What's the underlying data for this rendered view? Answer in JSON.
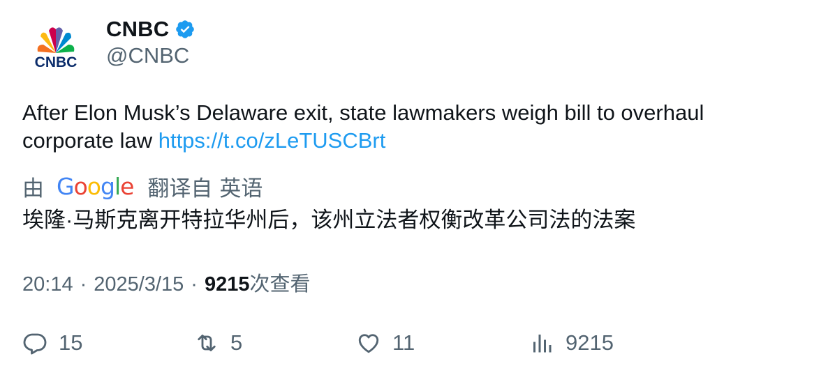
{
  "author": {
    "display_name": "CNBC",
    "handle": "@CNBC",
    "avatar_text": "CNBC",
    "verified_icon": "verified-badge-icon"
  },
  "tweet": {
    "text": "After Elon Musk’s Delaware exit, state lawmakers weigh bill to overhaul corporate law ",
    "link": "https://t.co/zLeTUSCBrt"
  },
  "translation": {
    "by_label": "由",
    "provider": "Google",
    "from_label": "翻译自",
    "source_language": "英语",
    "translated_text": "埃隆·马斯克离开特拉华州后，该州立法者权衡改革公司法的法案"
  },
  "meta": {
    "time": "20:14",
    "separator": "·",
    "date": "2025/3/15",
    "views_count": "9215",
    "views_label": "次查看"
  },
  "actions": {
    "replies": "15",
    "retweets": "5",
    "likes": "11",
    "views": "9215"
  },
  "colors": {
    "text_primary": "#0f1419",
    "text_secondary": "#536471",
    "link": "#1d9bf0",
    "verified": "#1d9bf0"
  }
}
